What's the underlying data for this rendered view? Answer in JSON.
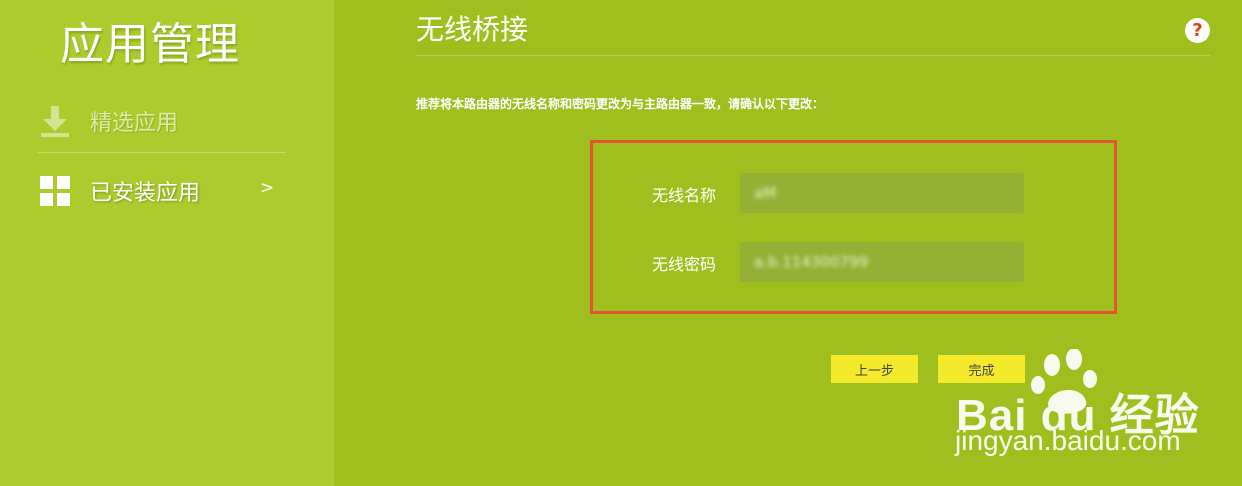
{
  "sidebar": {
    "title": "应用管理",
    "items": [
      {
        "label": "精选应用",
        "icon": "download-icon",
        "selected": false
      },
      {
        "label": "已安装应用",
        "icon": "grid-icon",
        "selected": true,
        "arrow": ">"
      }
    ]
  },
  "main": {
    "title": "无线桥接",
    "help_glyph": "?",
    "hint": "推荐将本路由器的无线名称和密码更改为与主路由器一致，请确认以下更改：",
    "fields": [
      {
        "label": "无线名称",
        "value": "aM"
      },
      {
        "label": "无线密码",
        "value": "a.b.114300799"
      }
    ],
    "buttons": {
      "prev": "上一步",
      "finish": "完成"
    }
  },
  "watermark": {
    "brand": "Bai du 经验",
    "url": "jingyan.baidu.com"
  },
  "colors": {
    "main_bg": "#a0bf1e",
    "sidebar_bg": "#aecb2e",
    "input_bg": "#94b136",
    "button_bg": "#f4ea2c",
    "highlight_border": "#e2552f",
    "help_icon_color": "#e0421f"
  }
}
